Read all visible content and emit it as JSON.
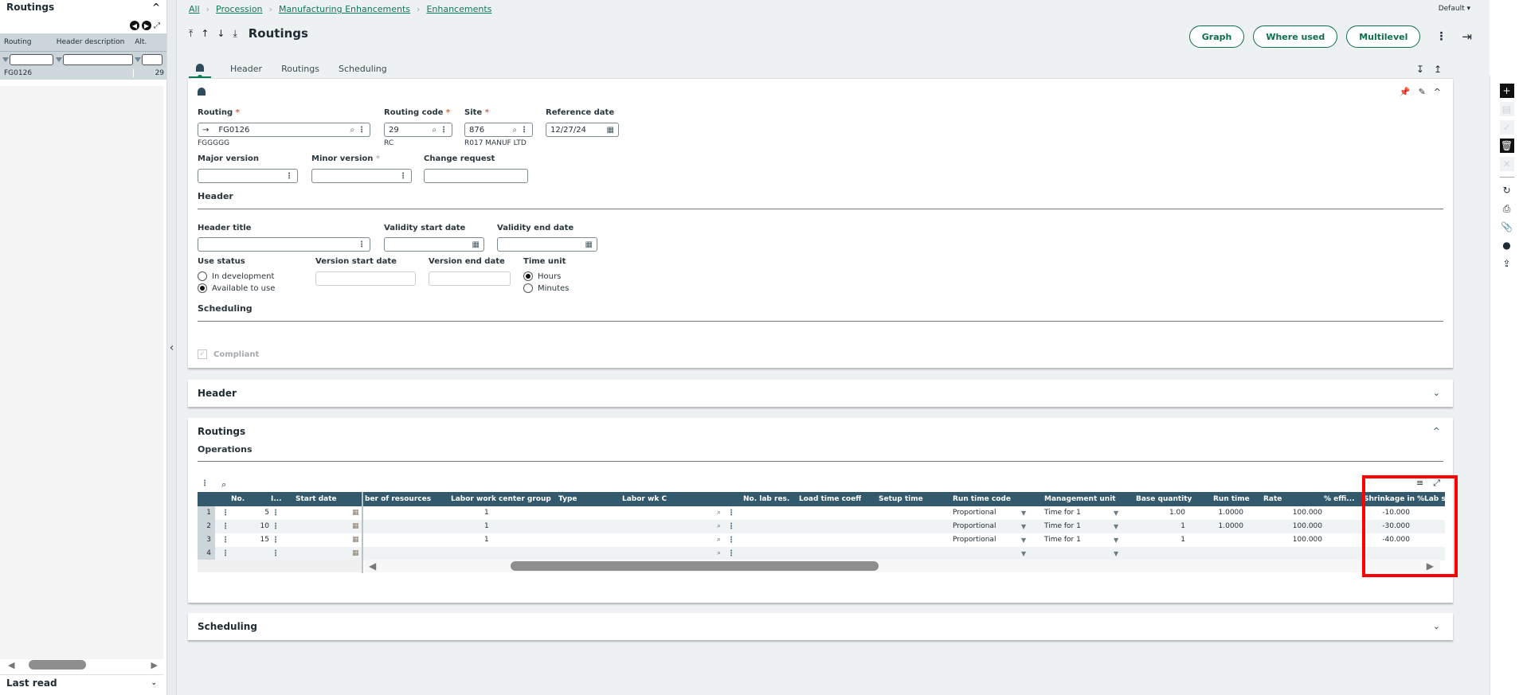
{
  "left_panel": {
    "title": "Routings",
    "columns": [
      "Routing",
      "Header description",
      "Alt."
    ],
    "rows": [
      {
        "routing": "FG0126",
        "header_description": "",
        "alt": "29"
      }
    ],
    "footer_title": "Last read"
  },
  "breadcrumb": [
    "All",
    "Procession",
    "Manufacturing Enhancements",
    "Enhancements"
  ],
  "page_title": "Routings",
  "default_label": "Default",
  "actions": {
    "graph": "Graph",
    "where_used": "Where used",
    "multilevel": "Multilevel"
  },
  "tabs": [
    "Header",
    "Routings",
    "Scheduling"
  ],
  "form": {
    "routing": {
      "label": "Routing",
      "value": "FG0126",
      "description": "FGGGGG"
    },
    "routing_code": {
      "label": "Routing code",
      "value": "29",
      "description": "RC"
    },
    "site": {
      "label": "Site",
      "value": "876",
      "description": "R017 MANUF LTD"
    },
    "reference_date": {
      "label": "Reference date",
      "value": "12/27/24"
    },
    "major_version": {
      "label": "Major version",
      "value": ""
    },
    "minor_version": {
      "label": "Minor version",
      "value": ""
    },
    "change_request": {
      "label": "Change request",
      "value": ""
    },
    "header_section": "Header",
    "header_title": {
      "label": "Header title",
      "value": ""
    },
    "validity_start_date": {
      "label": "Validity start date",
      "value": ""
    },
    "validity_end_date": {
      "label": "Validity end date",
      "value": ""
    },
    "use_status": {
      "label": "Use status",
      "options": [
        "In development",
        "Available to use"
      ],
      "selected": "Available to use"
    },
    "version_start_date": {
      "label": "Version start date",
      "value": ""
    },
    "version_end_date": {
      "label": "Version end date",
      "value": ""
    },
    "time_unit": {
      "label": "Time unit",
      "options": [
        "Hours",
        "Minutes"
      ],
      "selected": "Hours"
    },
    "scheduling_section": "Scheduling",
    "compliant": {
      "label": "Compliant",
      "checked": true
    }
  },
  "sections": {
    "header": "Header",
    "routings": "Routings",
    "operations": "Operations",
    "scheduling": "Scheduling"
  },
  "operations": {
    "columns": [
      "No.",
      "I...",
      "Start date",
      "ber of resources",
      "Labor work center group",
      "Type",
      "Labor wk C",
      "No. lab res.",
      "Load time coeff",
      "Setup time",
      "Run time code",
      "Management unit",
      "Base quantity",
      "Run time",
      "Rate",
      "% effi...",
      "Shrinkage in %",
      "Lab set f"
    ],
    "rows": [
      {
        "row": "1",
        "no": "5",
        "resources": "1",
        "run_time_code": "Proportional",
        "management_unit": "Time for 1",
        "base_quantity": "1.00",
        "run_time": "1.0000",
        "efficiency": "100.000",
        "shrinkage": "-10.000"
      },
      {
        "row": "2",
        "no": "10",
        "resources": "1",
        "run_time_code": "Proportional",
        "management_unit": "Time for 1",
        "base_quantity": "1",
        "run_time": "1.0000",
        "efficiency": "100.000",
        "shrinkage": "-30.000"
      },
      {
        "row": "3",
        "no": "15",
        "resources": "1",
        "run_time_code": "Proportional",
        "management_unit": "Time for 1",
        "base_quantity": "1",
        "run_time": "",
        "efficiency": "100.000",
        "shrinkage": "-40.000"
      },
      {
        "row": "4",
        "no": "",
        "resources": "",
        "run_time_code": "",
        "management_unit": "",
        "base_quantity": "",
        "run_time": "",
        "efficiency": "",
        "shrinkage": ""
      }
    ]
  },
  "colors": {
    "accent": "#0d7a56",
    "grid_header": "#335a6c",
    "highlight": "#ff0000"
  }
}
